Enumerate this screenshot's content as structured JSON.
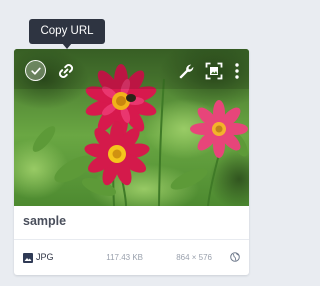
{
  "tooltip": {
    "text": "Copy URL"
  },
  "card": {
    "name": "sample",
    "type": "JPG",
    "size": "117.43 KB",
    "dimensions": "864 × 576",
    "type_icon": "image-icon",
    "visibility_icon": "globe-icon"
  },
  "overlay": {
    "select_icon": "checkmark-icon",
    "copy_icon": "link-icon",
    "edit_icon": "wrench-icon",
    "fit_icon": "focus-frame-icon",
    "more_icon": "more-vertical-icon"
  },
  "colors": {
    "background": "#e9ecf1",
    "tooltip": "#2e3441",
    "name_text": "#4a4f5c",
    "meta_text": "#9aa1ad"
  }
}
